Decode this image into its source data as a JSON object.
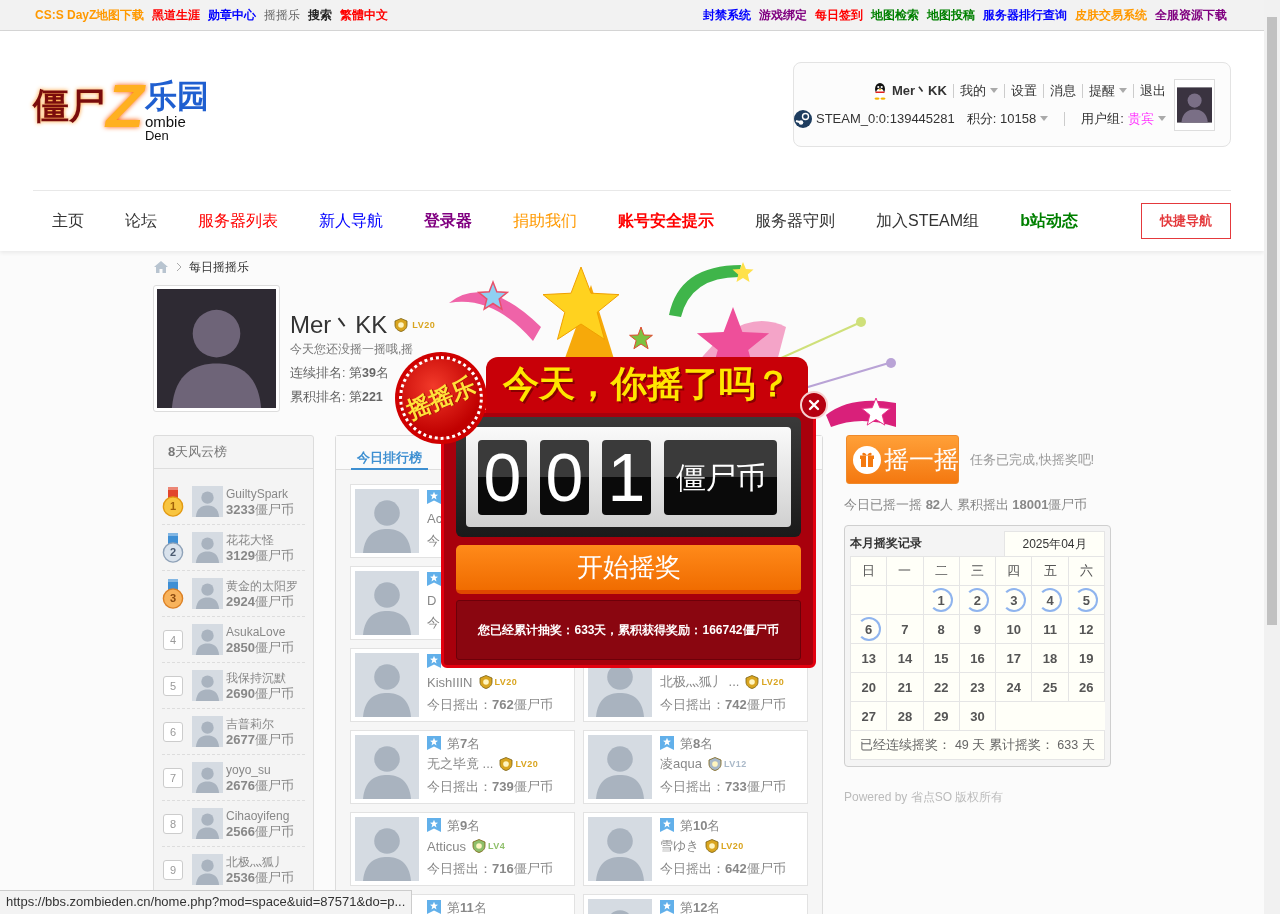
{
  "top_bar": {
    "left_links": [
      {
        "text": "CS:S DayZ地图下载",
        "color": "#ff9900",
        "bold": true
      },
      {
        "text": "黑道生涯",
        "color": "#ff0000",
        "bold": true
      },
      {
        "text": "勋章中心",
        "color": "#0000ff",
        "bold": true
      },
      {
        "text": "摇摇乐",
        "color": "#666666",
        "bold": false
      },
      {
        "text": "搜索",
        "color": "#222222",
        "bold": true
      },
      {
        "text": "繁體中文",
        "color": "#ff0000",
        "bold": true
      }
    ],
    "right_links": [
      {
        "text": "封禁系统",
        "color": "#0000ff",
        "bold": true
      },
      {
        "text": "游戏绑定",
        "color": "#800080",
        "bold": true
      },
      {
        "text": "每日签到",
        "color": "#ff0000",
        "bold": true
      },
      {
        "text": "地图检索",
        "color": "#008000",
        "bold": true
      },
      {
        "text": "地图投稿",
        "color": "#008000",
        "bold": true
      },
      {
        "text": "服务器排行查询",
        "color": "#0000ff",
        "bold": true
      },
      {
        "text": "皮肤交易系统",
        "color": "#ff9900",
        "bold": true
      },
      {
        "text": "全服资源下载",
        "color": "#800080",
        "bold": true
      }
    ]
  },
  "header": {
    "logo": {
      "cn_left": "僵尸",
      "letter": "Z",
      "cn_right": "乐园",
      "en_1": "ombie",
      "en_2": "Den"
    },
    "user_box": {
      "menu": [
        {
          "text": "Mer丶KK",
          "kind": "user",
          "dropdown": false
        },
        {
          "text": "我的",
          "kind": "link",
          "dropdown": true
        },
        {
          "text": "设置",
          "kind": "link",
          "dropdown": false
        },
        {
          "text": "消息",
          "kind": "link",
          "dropdown": false
        },
        {
          "text": "提醒",
          "kind": "link",
          "dropdown": true
        },
        {
          "text": "退出",
          "kind": "link",
          "dropdown": false
        }
      ],
      "steam_id": "STEAM_0:0:139445281",
      "points": "积分: 10158",
      "group_label": "用户组:",
      "group": "贵宾"
    }
  },
  "nav": {
    "items": [
      {
        "label": "主页",
        "color": "#333333",
        "bold": false
      },
      {
        "label": "论坛",
        "color": "#333333",
        "bold": false
      },
      {
        "label": "服务器列表",
        "color": "#ff0000",
        "bold": false
      },
      {
        "label": "新人导航",
        "color": "#0000ff",
        "bold": false
      },
      {
        "label": "登录器",
        "color": "#800080",
        "bold": true
      },
      {
        "label": "捐助我们",
        "color": "#ff9900",
        "bold": false
      },
      {
        "label": "账号安全提示",
        "color": "#ff0000",
        "bold": true
      },
      {
        "label": "服务器守则",
        "color": "#333333",
        "bold": false
      },
      {
        "label": "加入STEAM组",
        "color": "#333333",
        "bold": false
      },
      {
        "label": "b站动态",
        "color": "#008000",
        "bold": true
      }
    ],
    "quick_nav": "快捷导航"
  },
  "breadcrumb": {
    "current": "每日摇摇乐"
  },
  "profile": {
    "name": "Mer丶KK",
    "grade": {
      "text": "LV20",
      "color": "#d9a520"
    },
    "message": "今天您还没摇一摇哦,摇",
    "streak": "连续排名: 第**39**名",
    "total": "累积排名: 第**221**"
  },
  "leaderboard": {
    "title": "**8**天风云榜",
    "rows": [
      {
        "rank": "1",
        "kind": "gold",
        "name": "GuiltySpark",
        "coins": "**3233**僵尸币"
      },
      {
        "rank": "2",
        "kind": "silver",
        "name": "花花大怪",
        "coins": "**3129**僵尸币"
      },
      {
        "rank": "3",
        "kind": "bronze",
        "name": "黄金的太阳罗",
        "coins": "**2924**僵尸币"
      },
      {
        "rank": "4",
        "kind": "plain",
        "name": "AsukaLove",
        "coins": "**2850**僵尸币"
      },
      {
        "rank": "5",
        "kind": "plain",
        "name": "我保持沉默",
        "coins": "**2690**僵尸币"
      },
      {
        "rank": "6",
        "kind": "plain",
        "name": "吉普莉尔",
        "coins": "**2677**僵尸币"
      },
      {
        "rank": "7",
        "kind": "plain",
        "name": "yoyo_su",
        "coins": "**2676**僵尸币"
      },
      {
        "rank": "8",
        "kind": "plain",
        "name": "Cihaoyifeng",
        "coins": "**2566**僵尸币"
      },
      {
        "rank": "9",
        "kind": "plain",
        "name": "北极灬狐丿",
        "coins": "**2536**僵尸币"
      }
    ]
  },
  "ranking": {
    "tabs": [
      {
        "label": "今日排行榜",
        "selected": true
      }
    ],
    "rows": [
      {
        "left": {
          "ribbon": true,
          "avatar": true,
          "name": "Ac",
          "earned": "今"
        }
      },
      {
        "left": {
          "ribbon": true,
          "avatar": true,
          "name": "D",
          "earned": "今"
        }
      },
      {
        "left": {
          "ribbon": true,
          "avatar": true,
          "name": "KishIIIN",
          "grade": {
            "text": "LV20",
            "color": "#d9a520"
          },
          "earned": "今日摇出：**762**僵尸币"
        },
        "right": {
          "ribbon": false,
          "avatar": true,
          "name": "北极灬狐丿 ...",
          "grade": {
            "text": "LV20",
            "color": "#d9a520"
          },
          "earned": "今日摇出：**742**僵尸币"
        }
      },
      {
        "left": {
          "ribbon": true,
          "avatar": true,
          "rank": "第**7**名",
          "name": "无之毕竟 ...",
          "grade": {
            "text": "LV20",
            "color": "#d9a520"
          },
          "earned": "今日摇出：**739**僵尸币"
        },
        "right": {
          "ribbon": true,
          "avatar": true,
          "rank": "第**8**名",
          "name": "凌aqua",
          "grade": {
            "text": "LV12",
            "color": "#a9b8c8"
          },
          "earned": "今日摇出：**733**僵尸币"
        }
      },
      {
        "left": {
          "ribbon": true,
          "avatar": true,
          "rank": "第**9**名",
          "name": "Atticus",
          "grade": {
            "text": "LV4",
            "color": "#8fbf6a"
          },
          "earned": "今日摇出：**716**僵尸币"
        },
        "right": {
          "ribbon": true,
          "avatar": true,
          "rank": "第**10**名",
          "name": "雪ゆき",
          "grade": {
            "text": "LV20",
            "color": "#d9a520"
          },
          "earned": "今日摇出：**642**僵尸币"
        }
      },
      {
        "left": {
          "ribbon": true,
          "avatar": false,
          "rank": "第**11**名"
        },
        "right": {
          "ribbon": true,
          "avatar": true,
          "rank": "第**12**名"
        }
      }
    ]
  },
  "lottery": {
    "button": "摇一摇",
    "status": "任务已完成,快摇奖吧!",
    "stats": "今日已摇一摇 **82**人 累积摇出 **18001**僵尸币"
  },
  "calendar": {
    "title": "本月摇奖记录",
    "month": "2025年04月",
    "weekdays": [
      "日",
      "一",
      "二",
      "三",
      "四",
      "五",
      "六"
    ],
    "weeks": [
      [
        {
          "day": "1",
          "checked": true
        },
        {
          "day": "2",
          "checked": true
        },
        {
          "day": "3",
          "checked": true
        },
        {
          "day": "4",
          "checked": true
        },
        {
          "day": "5",
          "checked": true
        }
      ],
      [
        {
          "day": "6",
          "checked": true
        },
        {
          "day": "7",
          "checked": false
        },
        {
          "day": "8",
          "checked": false
        },
        {
          "day": "9",
          "checked": false
        },
        {
          "day": "10",
          "checked": false
        },
        {
          "day": "11",
          "checked": false
        },
        {
          "day": "12",
          "checked": false
        }
      ],
      [
        {
          "day": "13",
          "checked": false
        },
        {
          "day": "14",
          "checked": false
        },
        {
          "day": "15",
          "checked": false
        },
        {
          "day": "16",
          "checked": false
        },
        {
          "day": "17",
          "checked": false
        },
        {
          "day": "18",
          "checked": false
        },
        {
          "day": "19",
          "checked": false
        }
      ],
      [
        {
          "day": "20",
          "checked": false
        },
        {
          "day": "21",
          "checked": false
        },
        {
          "day": "22",
          "checked": false
        },
        {
          "day": "23",
          "checked": false
        },
        {
          "day": "24",
          "checked": false
        },
        {
          "day": "25",
          "checked": false
        },
        {
          "day": "26",
          "checked": false
        }
      ],
      [
        {
          "day": "27",
          "checked": false
        },
        {
          "day": "28",
          "checked": false
        },
        {
          "day": "29",
          "checked": false
        },
        {
          "day": "30",
          "checked": false
        }
      ]
    ],
    "footer": "已经连续摇奖： 49 天 累计摇奖： 633 天"
  },
  "footer": {
    "powered": "Powered by 省点SO 版权所有"
  },
  "popup": {
    "badge": "摇摇乐",
    "banner": "今天，你摇了吗？",
    "digits": [
      "0",
      "0",
      "1"
    ],
    "unit": "僵尸币",
    "button": "开始摇奖",
    "summary": "您已经累计抽奖：633天，累积获得奖励：166742僵尸币"
  },
  "status_url": "https://bbs.zombieden.cn/home.php?mod=space&uid=87571&do=p..."
}
